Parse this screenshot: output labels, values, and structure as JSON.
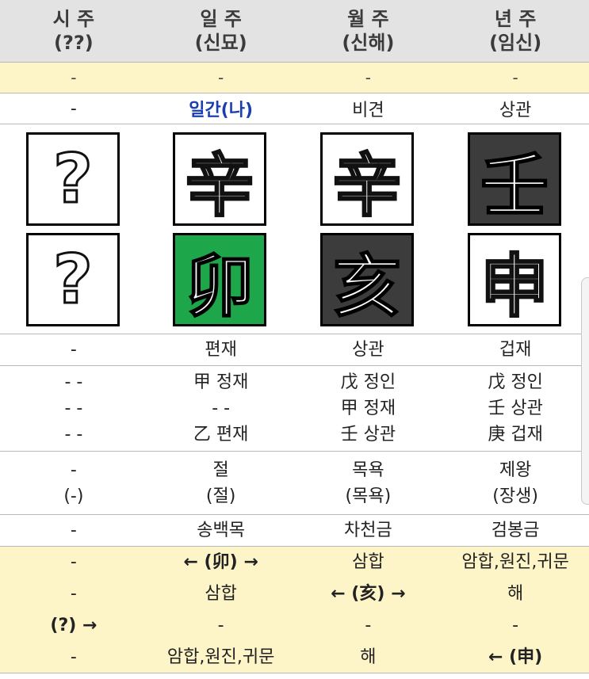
{
  "header": [
    {
      "title": "시 주",
      "sub": "(??)"
    },
    {
      "title": "일 주",
      "sub": "(신묘)"
    },
    {
      "title": "월 주",
      "sub": "(신해)"
    },
    {
      "title": "년 주",
      "sub": "(임신)"
    }
  ],
  "row_yellow": [
    "-",
    "-",
    "-",
    "-"
  ],
  "sipsin_top": [
    "-",
    "일간(나)",
    "비견",
    "상관"
  ],
  "heavenly_stems": [
    {
      "char": "?",
      "style": "white"
    },
    {
      "char": "辛",
      "style": "white"
    },
    {
      "char": "辛",
      "style": "white"
    },
    {
      "char": "壬",
      "style": "dark"
    }
  ],
  "earthly_branches": [
    {
      "char": "?",
      "style": "white"
    },
    {
      "char": "卯",
      "style": "green"
    },
    {
      "char": "亥",
      "style": "dark"
    },
    {
      "char": "申",
      "style": "white"
    }
  ],
  "sipsin_bottom": [
    "-",
    "편재",
    "상관",
    "겁재"
  ],
  "jijanggan": [
    [
      "- -",
      "- -",
      "- -"
    ],
    [
      "甲 정재",
      "- -",
      "乙 편재"
    ],
    [
      "戊 정인",
      "甲 정재",
      "壬 상관"
    ],
    [
      "戊 정인",
      "壬 상관",
      "庚 겁재"
    ]
  ],
  "unseong": [
    [
      "-",
      "(-)"
    ],
    [
      "절",
      "(절)"
    ],
    [
      "목욕",
      "(목욕)"
    ],
    [
      "제왕",
      "(장생)"
    ]
  ],
  "napeum": [
    "-",
    "송백목",
    "차천금",
    "검봉금"
  ],
  "relations": [
    [
      "-",
      "← (卯) →",
      "삼합",
      "암합,원진,귀문"
    ],
    [
      "-",
      "삼합",
      "← (亥) →",
      "해"
    ],
    [
      "(?) →",
      "-",
      "-",
      "-"
    ],
    [
      "-",
      "암합,원진,귀문",
      "해",
      "← (申)"
    ]
  ],
  "colors": {
    "header_bg": "#e3e3e3",
    "yellow_bg": "#fdf4c8",
    "ilgan_blue": "#1a3fb3",
    "green": "#1ea64a",
    "dark": "#3c3c3c"
  }
}
